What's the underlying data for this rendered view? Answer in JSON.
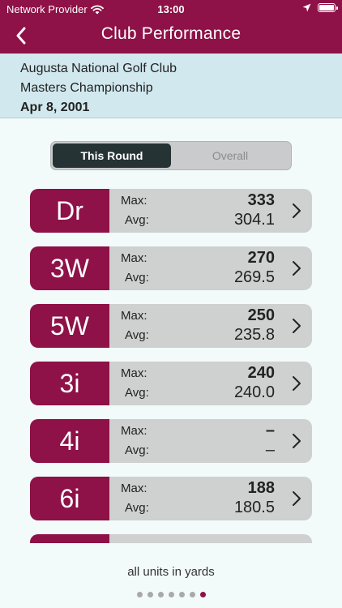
{
  "status_bar": {
    "carrier": "Network Provider",
    "time": "13:00"
  },
  "nav": {
    "title": "Club Performance"
  },
  "info": {
    "course": "Augusta National Golf Club",
    "event": "Masters Championship",
    "date": "Apr 8, 2001"
  },
  "segmented": {
    "options": [
      "This Round",
      "Overall"
    ],
    "selected": "This Round"
  },
  "labels": {
    "max": "Max:",
    "avg": "Avg:"
  },
  "clubs": [
    {
      "name": "Dr",
      "max": "333",
      "avg": "304.1"
    },
    {
      "name": "3W",
      "max": "270",
      "avg": "269.5"
    },
    {
      "name": "5W",
      "max": "250",
      "avg": "235.8"
    },
    {
      "name": "3i",
      "max": "240",
      "avg": "240.0"
    },
    {
      "name": "4i",
      "max": "–",
      "avg": "–"
    },
    {
      "name": "6i",
      "max": "188",
      "avg": "180.5"
    }
  ],
  "footer": {
    "note": "all units in yards"
  },
  "page_indicator": {
    "count": 7,
    "active_index": 6
  },
  "colors": {
    "brand": "#8e1147",
    "info_bg": "#d1e8ee",
    "row_bg": "#cfd0d0",
    "segment_active": "#263334"
  }
}
